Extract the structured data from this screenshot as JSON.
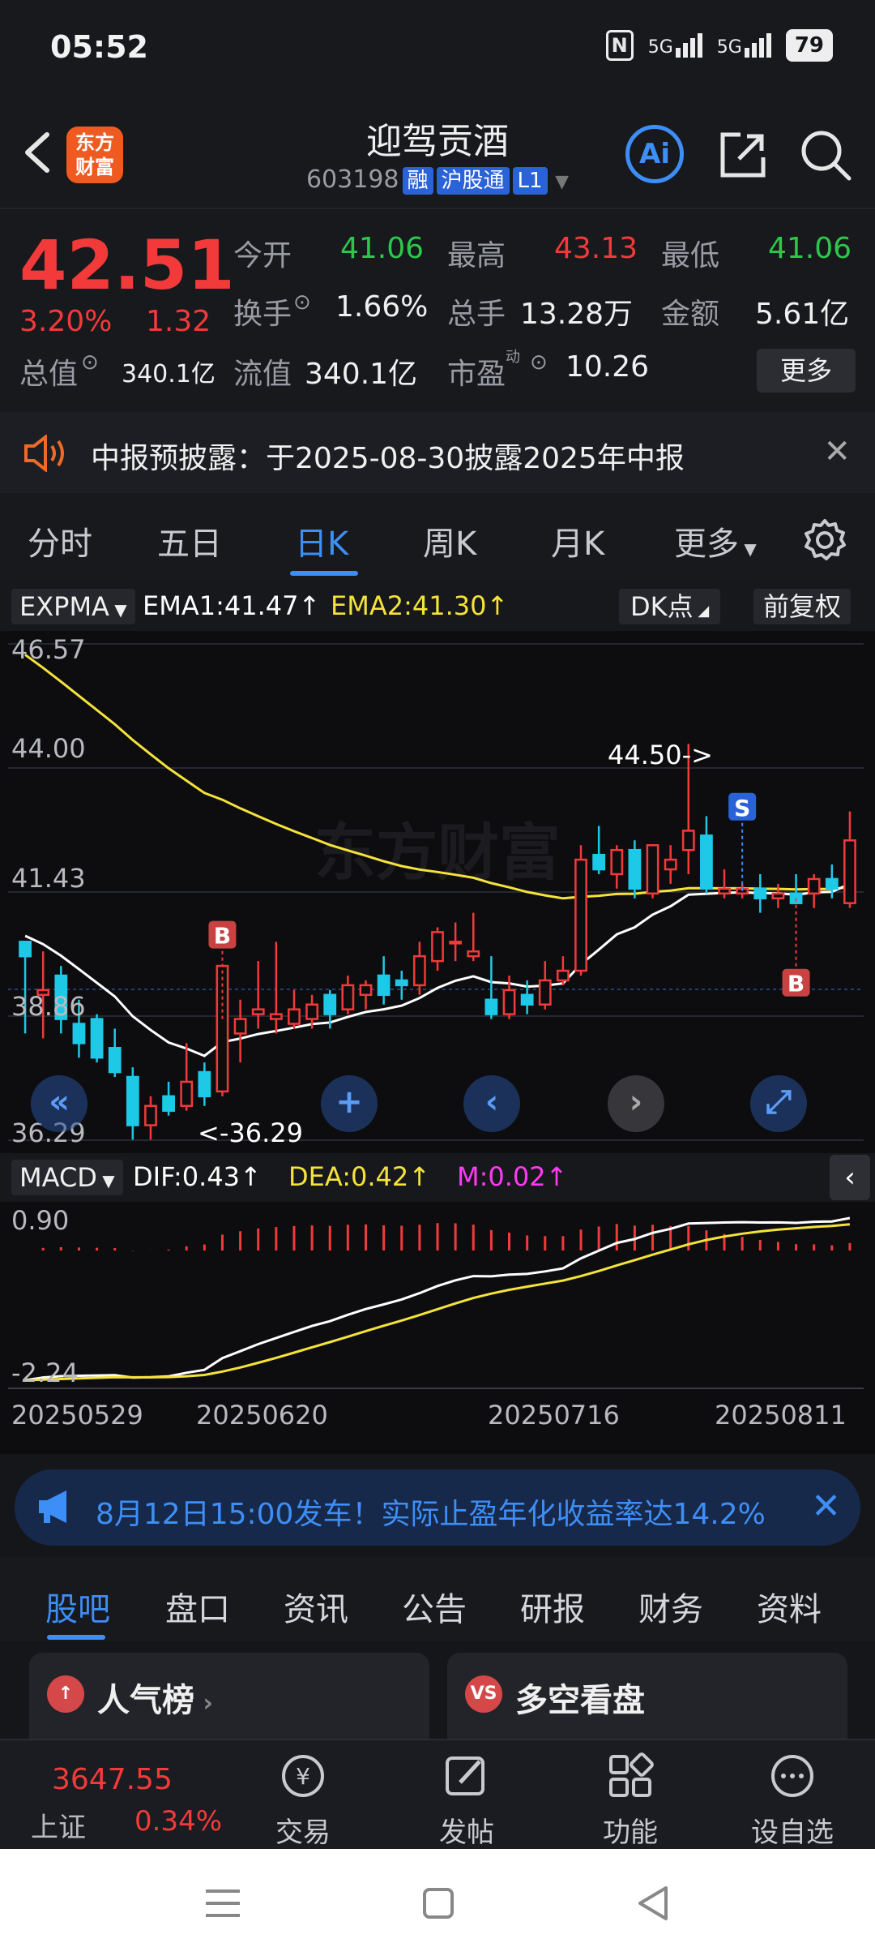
{
  "status": {
    "time": "05:52",
    "signal1": "5G",
    "signal2": "5G",
    "battery": "79"
  },
  "header": {
    "logo_line1": "东方",
    "logo_line2": "财富",
    "name": "迎驾贡酒",
    "code": "603198",
    "tags": [
      "融",
      "沪股通",
      "L1"
    ],
    "ai_label": "Ai"
  },
  "quote": {
    "price": "42.51",
    "change_pct": "3.20%",
    "change": "1.32",
    "open_label": "今开",
    "open": "41.06",
    "high_label": "最高",
    "high": "43.13",
    "low_label": "最低",
    "low": "41.06",
    "turnover_label": "换手",
    "turnover": "1.66%",
    "volume_label": "总手",
    "volume": "13.28万",
    "amount_label": "金额",
    "amount": "5.61亿",
    "mcap_label": "总值",
    "mcap": "340.1亿",
    "float_label": "流值",
    "float": "340.1亿",
    "pe_label": "市盈",
    "pe_sup": "动",
    "pe": "10.26",
    "more": "更多"
  },
  "notice": {
    "text": "中报预披露：于2025-08-30披露2025年中报"
  },
  "tabs": [
    "分时",
    "五日",
    "日K",
    "周K",
    "月K",
    "更多"
  ],
  "chart": {
    "indicator": "EXPMA",
    "ema1": "EMA1:41.47",
    "ema2": "EMA2:41.30",
    "dk": "DK点",
    "adjust": "前复权",
    "y_labels": [
      "46.57",
      "44.00",
      "41.43",
      "38.86",
      "36.29"
    ],
    "high_marker": "44.50->",
    "low_marker": "<-36.29",
    "buy_label": "B",
    "sell_label": "S",
    "macd_label": "MACD",
    "dif": "DIF:0.43",
    "dea": "DEA:0.42",
    "m": "M:0.02",
    "macd_y": [
      "0.90",
      "-2.24"
    ],
    "dates": [
      "20250529",
      "20250620",
      "20250716",
      "20250811"
    ],
    "watermark": "东方财富"
  },
  "chart_data": {
    "type": "candlestick",
    "ylim": [
      36.29,
      46.57
    ],
    "candles": [
      [
        40.4,
        40.4,
        38.5,
        40.1
      ],
      [
        39.3,
        40.2,
        38.4,
        39.4
      ],
      [
        39.7,
        39.9,
        38.5,
        38.8
      ],
      [
        38.7,
        39.2,
        38.0,
        38.3
      ],
      [
        38.8,
        38.9,
        37.9,
        38.0
      ],
      [
        38.2,
        38.6,
        37.6,
        37.7
      ],
      [
        37.6,
        37.8,
        36.3,
        36.6
      ],
      [
        36.6,
        37.2,
        36.3,
        37.0
      ],
      [
        37.2,
        37.5,
        36.8,
        36.9
      ],
      [
        37.0,
        38.3,
        36.9,
        37.5
      ],
      [
        37.7,
        37.9,
        37.0,
        37.2
      ],
      [
        37.3,
        39.9,
        37.2,
        39.9
      ],
      [
        38.5,
        39.2,
        37.9,
        38.8
      ],
      [
        38.9,
        40.0,
        38.6,
        39.0
      ],
      [
        38.8,
        40.4,
        38.5,
        38.9
      ],
      [
        38.7,
        39.4,
        38.6,
        39.0
      ],
      [
        38.8,
        39.3,
        38.6,
        39.1
      ],
      [
        39.3,
        39.4,
        38.6,
        38.9
      ],
      [
        39.0,
        39.7,
        38.9,
        39.5
      ],
      [
        39.3,
        39.6,
        39.0,
        39.5
      ],
      [
        39.7,
        40.1,
        39.1,
        39.3
      ],
      [
        39.6,
        39.8,
        39.2,
        39.5
      ],
      [
        39.5,
        40.4,
        39.3,
        40.1
      ],
      [
        40.0,
        40.7,
        39.8,
        40.6
      ],
      [
        40.4,
        40.8,
        40.0,
        40.4
      ],
      [
        40.1,
        41.0,
        40.0,
        40.2
      ],
      [
        39.2,
        40.1,
        38.8,
        38.9
      ],
      [
        38.9,
        39.7,
        38.8,
        39.4
      ],
      [
        39.3,
        39.6,
        38.9,
        39.1
      ],
      [
        39.1,
        40.0,
        39.0,
        39.6
      ],
      [
        39.6,
        40.1,
        39.5,
        39.8
      ],
      [
        39.8,
        42.4,
        39.7,
        42.1
      ],
      [
        42.2,
        42.8,
        41.8,
        41.9
      ],
      [
        41.8,
        42.4,
        41.5,
        42.3
      ],
      [
        42.3,
        42.5,
        41.3,
        41.5
      ],
      [
        41.4,
        42.4,
        41.3,
        42.4
      ],
      [
        41.9,
        42.4,
        41.6,
        42.1
      ],
      [
        42.3,
        44.5,
        41.8,
        42.7
      ],
      [
        42.6,
        43.0,
        41.4,
        41.5
      ],
      [
        41.4,
        41.9,
        41.3,
        41.5
      ],
      [
        41.4,
        41.6,
        41.3,
        41.5
      ],
      [
        41.5,
        41.8,
        41.0,
        41.3
      ],
      [
        41.3,
        41.6,
        41.1,
        41.4
      ],
      [
        41.4,
        41.8,
        41.2,
        41.2
      ],
      [
        41.4,
        41.8,
        41.1,
        41.7
      ],
      [
        41.7,
        42.0,
        41.3,
        41.5
      ],
      [
        41.2,
        43.1,
        41.1,
        42.5
      ]
    ]
  },
  "banner": {
    "text": "8月12日15:00发车！实际止盈年化收益率达14.2%"
  },
  "sub_tabs": [
    "股吧",
    "盘口",
    "资讯",
    "公告",
    "研报",
    "财务",
    "资料"
  ],
  "cards": [
    {
      "icon": "↑",
      "title": "人气榜"
    },
    {
      "icon": "VS",
      "title": "多空看盘"
    }
  ],
  "bottom": {
    "index_value": "3647.55",
    "index_name": "上证",
    "index_pct": "0.34%",
    "items": [
      "交易",
      "发帖",
      "功能",
      "设自选"
    ]
  },
  "colors": {
    "up": "#f23a3a",
    "down": "#1ec9e8",
    "accent": "#3e8ef7",
    "ema1": "#ffffff",
    "ema2": "#f5e33a"
  }
}
